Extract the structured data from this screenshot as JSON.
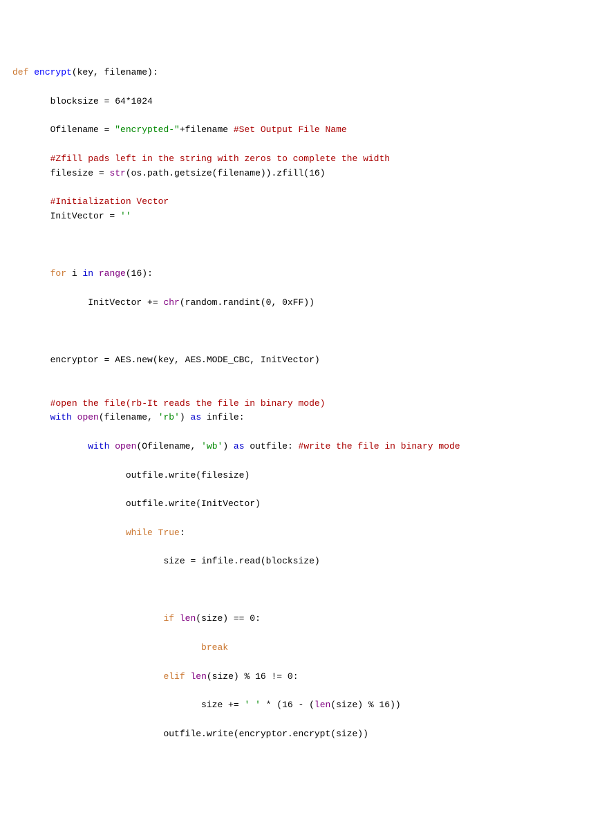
{
  "code": {
    "def": "def",
    "encrypt": "encrypt",
    "sig": "(key, filename):",
    "l1": "blocksize = 64*1024",
    "l2a": "Ofilename = ",
    "l2b": "\"encrypted-\"",
    "l2c": "+filename ",
    "l2d": "#Set Output File Name",
    "l3": "#Zfill pads left in the string with zeros to complete the width",
    "l4a": "filesize = ",
    "l4b": "str",
    "l4c": "(os.path.getsize(filename)).zfill(16)",
    "l5": "#Initialization Vector",
    "l6a": "InitVector = ",
    "l6b": "''",
    "for": "for",
    "l7a": " i ",
    "in": "in",
    "range": "range",
    "l7b": "(16):",
    "l8a": "InitVector += ",
    "chr": "chr",
    "l8b": "(random.randint(0, 0xFF))",
    "l9": "encryptor = AES.new(key, AES.MODE_CBC, InitVector)",
    "l10": "#open the file(rb-It reads the file in binary mode)",
    "with": "with",
    "open": "open",
    "l11a": "(filename, ",
    "rb": "'rb'",
    "l11b": ") ",
    "as": "as",
    "l11c": " infile:",
    "l12a": "(Ofilename, ",
    "wb": "'wb'",
    "l12b": ") ",
    "l12c": " outfile: ",
    "l12d": "#write the file in binary mode",
    "l13": "outfile.write(filesize)",
    "l14": "outfile.write(InitVector)",
    "while": "while",
    "true": "True",
    "colon": ":",
    "l15": "size = infile.read(blocksize)",
    "if": "if",
    "len": "len",
    "l16a": "(size) == 0:",
    "break": "break",
    "elif": "elif",
    "l17a": "(size) % 16 != 0:",
    "l18a": "size += ",
    "space": "' '",
    "l18b": " * (16 - (",
    "l18c": "(size) % 16))",
    "l19": "outfile.write(encryptor.encrypt(size))"
  }
}
